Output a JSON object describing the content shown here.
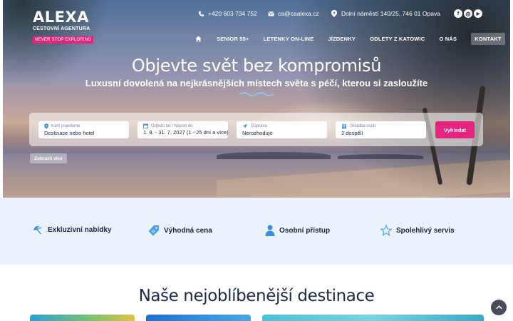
{
  "header": {
    "logo": {
      "brand": "ALEXA",
      "subtitle": "CESTOVNÍ AGENTURA",
      "tagline": "NEVER STOP EXPLORING"
    },
    "contact": {
      "phone": "+420 603 734 752",
      "email": "ca@caalexa.cz",
      "address": "Dolní náměstí 140/25, 746 01 Opava"
    },
    "social": [
      {
        "icon": "facebook-icon",
        "glyph": "f"
      },
      {
        "icon": "instagram-icon",
        "glyph": "◎"
      },
      {
        "icon": "youtube-icon",
        "glyph": "▶"
      }
    ],
    "nav": {
      "home_icon": "home-icon",
      "items": [
        "SENIOR 55+",
        "LETENKY ON-LINE",
        "JÍZDENKY",
        "ODLETY Z KATOWIC",
        "O NÁS",
        "KONTAKT"
      ],
      "active": "KONTAKT"
    }
  },
  "hero": {
    "title": "Objevte svět bez kompromisů",
    "subtitle": "Luxusní dovolená na nejkrásnějších místech světa s péčí, kterou si zasloužíte"
  },
  "search": {
    "destination": {
      "label": "Kam pojedeme",
      "value": "Destinace nebo hotel",
      "icon": "location-pin-icon"
    },
    "dates": {
      "label": "Odjezd od / Návrat do",
      "value": "1. 8. - 31. 7. 2027 (1 - 25 dní a více)",
      "icon": "calendar-icon"
    },
    "transport": {
      "label": "Doprava",
      "value": "Nerozhoduje",
      "icon": "plane-icon"
    },
    "people": {
      "label": "Skladba osob",
      "value": "2 dospělí",
      "icon": "people-icon"
    },
    "submit_label": "Vyhledat",
    "more_label": "Zobrazit více"
  },
  "features": [
    {
      "label": "Exkluzivní nabídky",
      "icon": "parasol-icon"
    },
    {
      "label": "Výhodná cena",
      "icon": "price-tag-icon"
    },
    {
      "label": "Osobní přístup",
      "icon": "person-icon"
    },
    {
      "label": "Spolehlivý servis",
      "icon": "star-icon"
    }
  ],
  "destinations": {
    "title": "Naše nejoblíbenější destinace"
  },
  "colors": {
    "accent": "#e4247e",
    "navy": "#1c2340",
    "features_bg": "#eaf3fb",
    "icon_blue": "#3a8fd6"
  }
}
